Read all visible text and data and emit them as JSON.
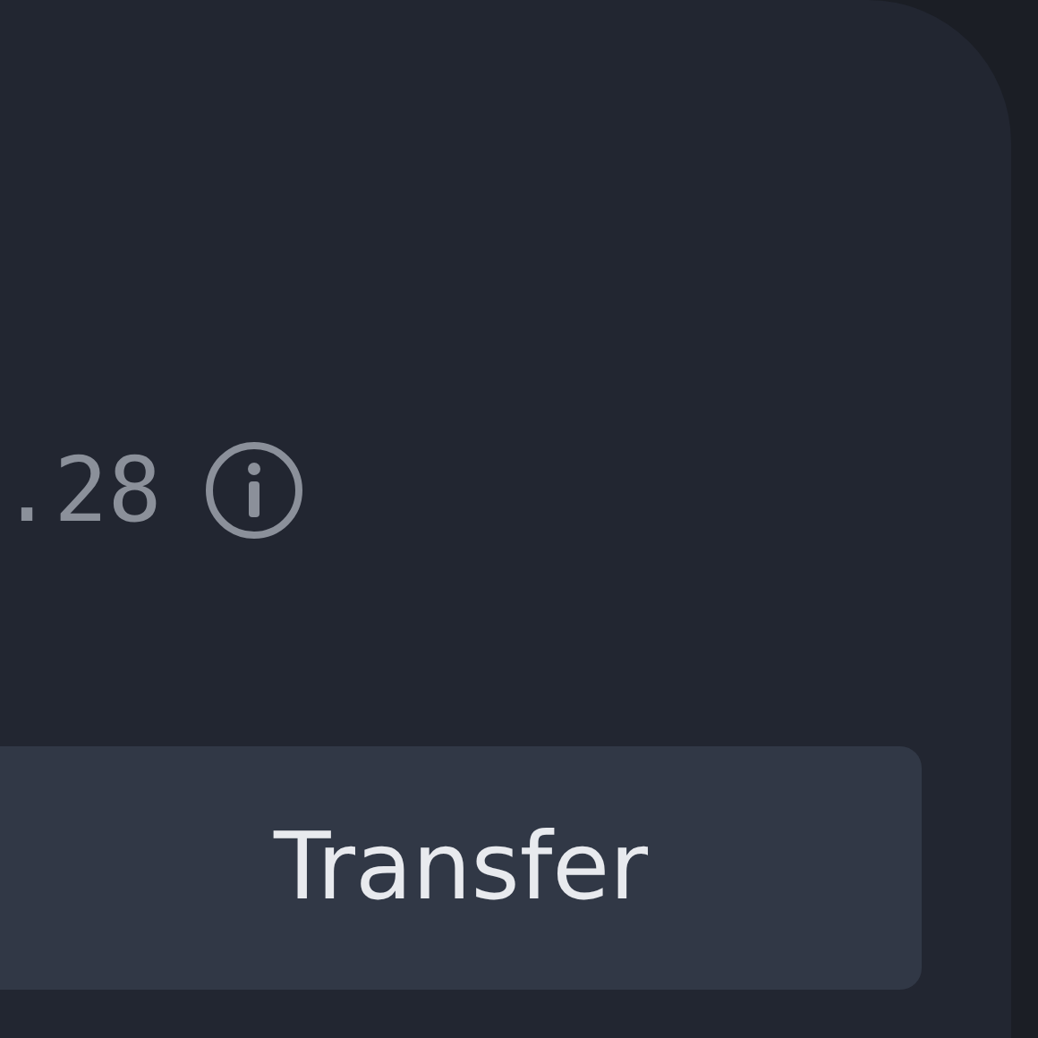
{
  "balance": {
    "value": ".28"
  },
  "button": {
    "label": "Transfer"
  }
}
